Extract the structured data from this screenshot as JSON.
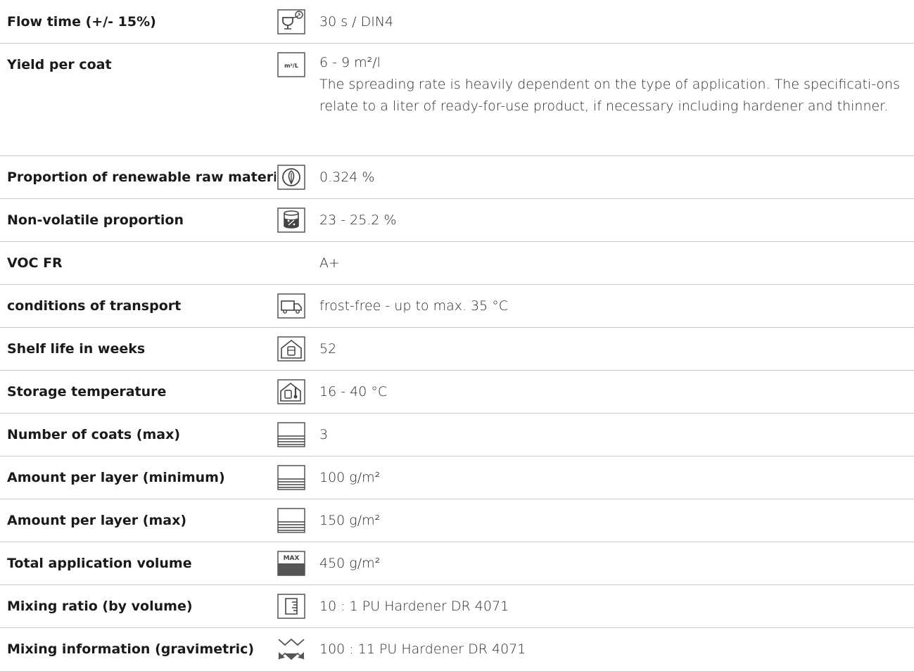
{
  "rows": [
    {
      "label": "Flow time (+/- 15%)",
      "icon": "flow-cup-timer-icon",
      "value": "30 s / DIN4"
    },
    {
      "label": "Yield per coat",
      "icon": "m2-per-liter-icon",
      "icon_text": "m²/L",
      "value": "6 - 9 m²/l",
      "note": "The spreading rate is heavily dependent on the type of application. The specificati-ons relate to a liter of ready-for-use product, if necessary including hardener and thinner."
    },
    {
      "label": "Proportion of renewable raw materi-",
      "icon": "leaf-circle-icon",
      "value": "0.324 %"
    },
    {
      "label": "Non-volatile proportion",
      "icon": "can-percent-icon",
      "value": "23 - 25.2 %"
    },
    {
      "label": "VOC FR",
      "icon": "",
      "value": "A+"
    },
    {
      "label": "conditions of transport",
      "icon": "truck-icon",
      "value": "frost-free - up to max. 35 °C"
    },
    {
      "label": "Shelf life in weeks",
      "icon": "house-can-icon",
      "value": "52"
    },
    {
      "label": "Storage temperature",
      "icon": "house-thermometer-icon",
      "value": "16 - 40 °C"
    },
    {
      "label": "Number of coats (max)",
      "icon": "layers-icon",
      "value": "3"
    },
    {
      "label": "Amount per layer (minimum)",
      "icon": "layers-icon",
      "value": "100 g/m²"
    },
    {
      "label": "Amount per layer (max)",
      "icon": "layers-icon",
      "value": "150 g/m²"
    },
    {
      "label": "Total application volume",
      "icon": "max-volume-icon",
      "icon_text": "MAX",
      "value": "450 g/m²"
    },
    {
      "label": "Mixing ratio (by volume)",
      "icon": "measuring-cup-icon",
      "value": "10 : 1 PU Hardener DR 4071"
    },
    {
      "label": "Mixing information (gravimetric)",
      "icon": "balance-scale-icon",
      "value": "100 : 11 PU Hardener DR 4071"
    }
  ]
}
